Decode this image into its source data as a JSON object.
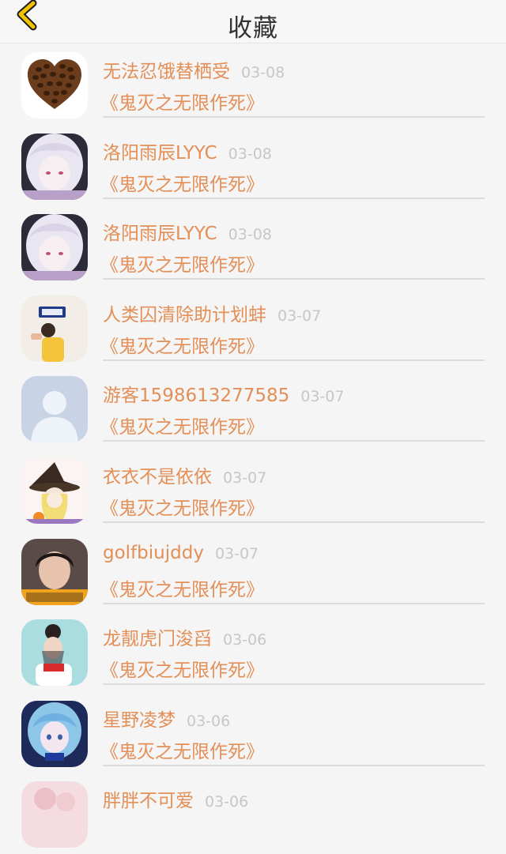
{
  "header": {
    "title": "收藏"
  },
  "items": [
    {
      "name": "无法忍饿替栖受",
      "date": "03-08",
      "book": "《鬼灭之无限作死》",
      "avatar_icon": "heart-coffee-beans-avatar"
    },
    {
      "name": "洛阳雨辰LYYC",
      "date": "03-08",
      "book": "《鬼灭之无限作死》",
      "avatar_icon": "anime-white-hair-avatar"
    },
    {
      "name": "洛阳雨辰LYYC",
      "date": "03-08",
      "book": "《鬼灭之无限作死》",
      "avatar_icon": "anime-white-hair-avatar"
    },
    {
      "name": "人类囚清除助计划蚌",
      "date": "03-07",
      "book": "《鬼灭之无限作死》",
      "avatar_icon": "person-fila-avatar"
    },
    {
      "name": "游客1598613277585",
      "date": "03-07",
      "book": "《鬼灭之无限作死》",
      "avatar_icon": "default-user-avatar"
    },
    {
      "name": "衣衣不是依依",
      "date": "03-07",
      "book": "《鬼灭之无限作死》",
      "avatar_icon": "witch-girl-avatar"
    },
    {
      "name": "golfbiujddy",
      "date": "03-07",
      "book": "《鬼灭之无限作死》",
      "avatar_icon": "boy-photo-avatar"
    },
    {
      "name": "龙靓虎门浚舀",
      "date": "03-06",
      "book": "《鬼灭之无限作死》",
      "avatar_icon": "girl-red-scarf-avatar"
    },
    {
      "name": "星野凌梦",
      "date": "03-06",
      "book": "《鬼灭之无限作死》",
      "avatar_icon": "blue-hair-anime-avatar"
    },
    {
      "name": "胖胖不可爱",
      "date": "03-06",
      "book": "",
      "avatar_icon": "pink-avatar"
    }
  ],
  "colors": {
    "accent": "#e38f57",
    "date": "#c7c7c7",
    "back_arrow": "#f2c300"
  }
}
